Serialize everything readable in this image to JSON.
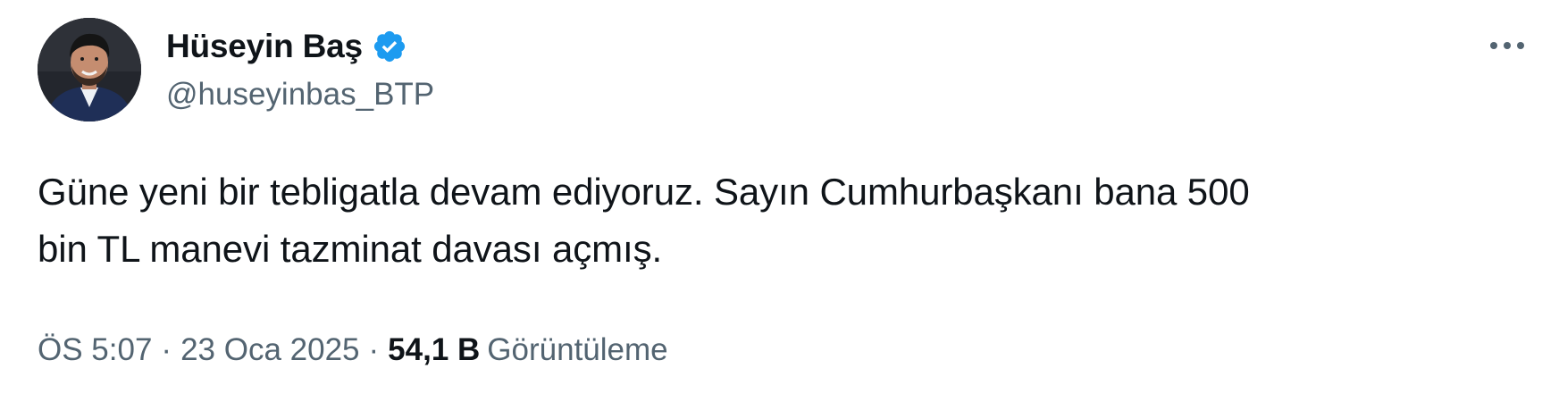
{
  "author": {
    "display_name": "Hüseyin Baş",
    "handle": "@huseyinbas_BTP",
    "verified": true,
    "avatar_icon": "profile-photo"
  },
  "tweet": {
    "text_lines": [
      "Güne yeni bir tebligatla devam ediyoruz. Sayın Cumhurbaşkanı bana 500",
      "bin TL manevi tazminat davası açmış."
    ],
    "time": "ÖS 5:07",
    "date": "23 Oca 2025",
    "separator": "·",
    "views_count": "54,1 B",
    "views_label": "Görüntüleme"
  },
  "icons": {
    "verified": "verified-badge-icon",
    "more": "more-options-icon"
  },
  "colors": {
    "verified_blue": "#1d9bf0",
    "secondary_text": "#536471",
    "primary_text": "#0f1419"
  }
}
